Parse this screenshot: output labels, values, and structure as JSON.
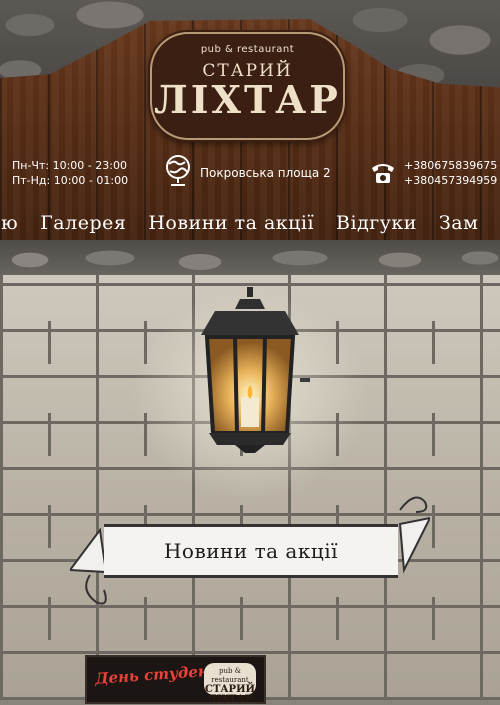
{
  "brand": {
    "tagline": "pub & restaurant",
    "line1": "СТАРИЙ",
    "line2": "ЛІХТАР"
  },
  "hours": {
    "weekdays": "Пн-Чт: 10:00 - 23:00",
    "weekend": "Пт-Нд: 10:00 - 01:00"
  },
  "address": "Покровська площа 2",
  "phones": [
    "+380675839675",
    "+380457394959"
  ],
  "nav": {
    "items": [
      "ню",
      "Галерея",
      "Новини та акції",
      "Відгуки",
      "Зам"
    ]
  },
  "section_title": "Новини та акції",
  "news": {
    "thumb_title": "День студента",
    "thumb_logo_small": "pub & restaurant",
    "thumb_logo_text": "СТАРИЙ ЛІХТАР"
  },
  "colors": {
    "wood": "#5a2f17",
    "logo_bg": "#3a1f12",
    "logo_text": "#efe1c8",
    "news_red": "#e8423a"
  },
  "icons": [
    "globe-icon",
    "phone-icon",
    "lantern-image"
  ]
}
